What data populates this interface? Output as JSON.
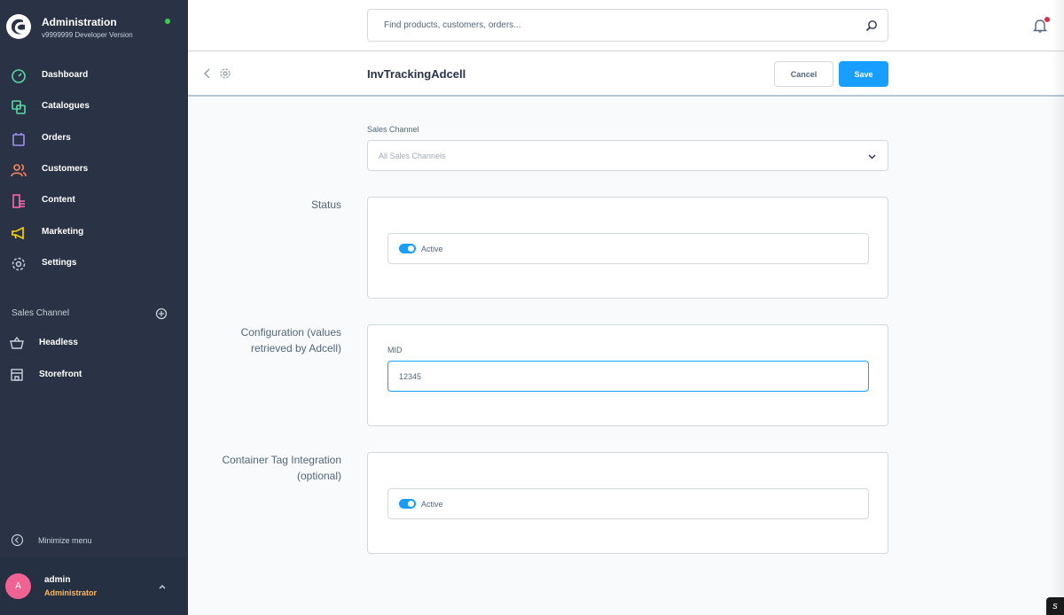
{
  "sidebar": {
    "brand_title": "Administration",
    "brand_version": "v9999999 Developer Version",
    "items": [
      {
        "label": "Dashboard",
        "icon": "dashboard-icon",
        "color": "#57d9a3"
      },
      {
        "label": "Catalogues",
        "icon": "catalogue-icon",
        "color": "#57d9a3"
      },
      {
        "label": "Orders",
        "icon": "orders-icon",
        "color": "#a092f0"
      },
      {
        "label": "Customers",
        "icon": "customers-icon",
        "color": "#f88962"
      },
      {
        "label": "Content",
        "icon": "content-icon",
        "color": "#ff68b4"
      },
      {
        "label": "Marketing",
        "icon": "marketing-icon",
        "color": "#ffd700"
      },
      {
        "label": "Settings",
        "icon": "settings-icon",
        "color": "#c7d0da"
      }
    ],
    "sales_channel_heading": "Sales Channel",
    "sales_channels": [
      {
        "label": "Headless",
        "icon": "basket-icon"
      },
      {
        "label": "Storefront",
        "icon": "storefront-icon"
      }
    ],
    "minimize_label": "Minimize menu",
    "user": {
      "initial": "A",
      "name": "admin",
      "role": "Administrator"
    }
  },
  "topbar": {
    "search_placeholder": "Find products, customers, orders..."
  },
  "smartbar": {
    "title": "InvTrackingAdcell",
    "cancel_label": "Cancel",
    "save_label": "Save"
  },
  "form": {
    "sales_channel_label": "Sales Channel",
    "sales_channel_value": "All Sales Channels",
    "status_title": "Status",
    "status_active_label": "Active",
    "config_title_line1": "Configuration (values",
    "config_title_line2": "retrieved by Adcell)",
    "mid_label": "MID",
    "mid_value": "12345",
    "container_title_line1": "Container Tag Integration",
    "container_title_line2": "(optional)",
    "container_active_label": "Active"
  },
  "colors": {
    "sidebar_bg": "#2a3345",
    "accent": "#189eff",
    "avatar": "#f06292",
    "role": "#ffb75d"
  }
}
